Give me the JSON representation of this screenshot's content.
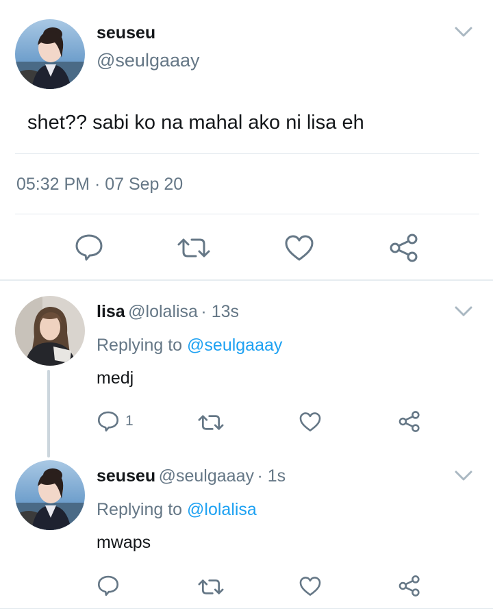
{
  "main_tweet": {
    "name": "seuseu",
    "handle": "@seulgaaay",
    "text": "shet?? sabi ko na mahal ako ni lisa eh",
    "timestamp": "05:32 PM · 07 Sep 20",
    "avatar_icon": "profile-photo"
  },
  "replies": [
    {
      "name": "lisa",
      "handle": "@lolalisa",
      "time": "· 13s",
      "replying_prefix": "Replying to",
      "replying_to": "@seulgaaay",
      "text": "medj",
      "reply_count": "1"
    },
    {
      "name": "seuseu",
      "handle": "@seulgaaay",
      "time": "· 1s",
      "replying_prefix": "Replying to",
      "replying_to": "@lolalisa",
      "text": "mwaps",
      "reply_count": ""
    }
  ],
  "icons": {
    "reply": "reply-icon",
    "retweet": "retweet-icon",
    "like": "like-icon",
    "share": "share-icon",
    "more": "chevron-down-icon"
  },
  "colors": {
    "text": "#14171a",
    "secondary": "#657786",
    "link": "#1da1f2",
    "divider": "#e1e8ed"
  }
}
